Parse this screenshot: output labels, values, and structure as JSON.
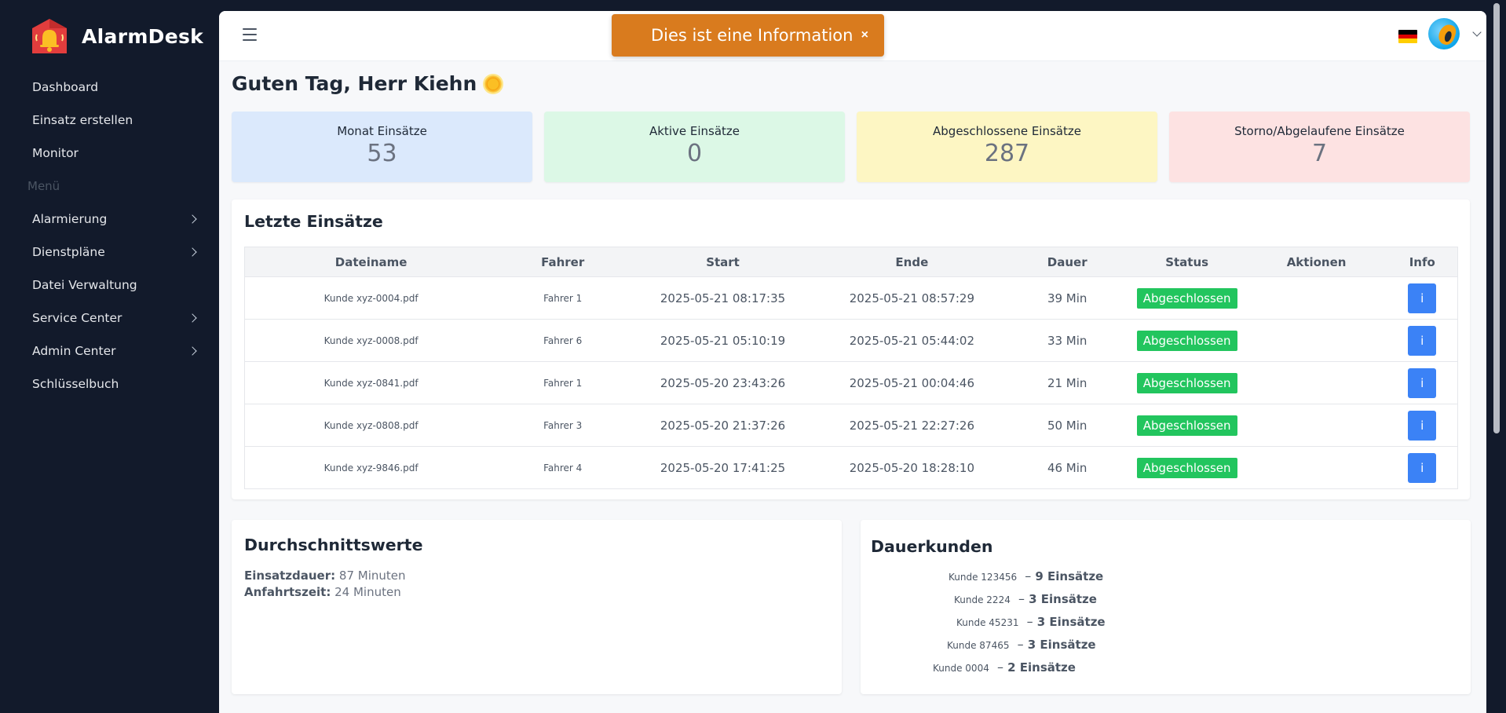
{
  "app": {
    "name": "AlarmDesk"
  },
  "sidebar": {
    "items": [
      {
        "label": "Dashboard"
      },
      {
        "label": "Einsatz erstellen"
      },
      {
        "label": "Monitor"
      }
    ],
    "section_label": "Menü",
    "menu_items": [
      {
        "label": "Alarmierung",
        "has_submenu": true
      },
      {
        "label": "Dienstpläne",
        "has_submenu": true
      },
      {
        "label": "Datei Verwaltung",
        "has_submenu": false
      },
      {
        "label": "Service Center",
        "has_submenu": true
      },
      {
        "label": "Admin Center",
        "has_submenu": true
      },
      {
        "label": "Schlüsselbuch",
        "has_submenu": false
      }
    ]
  },
  "toast": {
    "message": "Dies ist eine Information",
    "close_label": "×"
  },
  "header": {
    "language_flag": "de-flag-icon"
  },
  "greeting": {
    "text": "Guten Tag, Herr Kiehn"
  },
  "stats": [
    {
      "label": "Monat Einsätze",
      "value": "53",
      "color": "#dbe9fc"
    },
    {
      "label": "Aktive Einsätze",
      "value": "0",
      "color": "#dcf8e6"
    },
    {
      "label": "Abgeschlossene Einsätze",
      "value": "287",
      "color": "#fdf6c3"
    },
    {
      "label": "Storno/Abgelaufene Einsätze",
      "value": "7",
      "color": "#fde2e2"
    }
  ],
  "recent": {
    "title": "Letzte Einsätze",
    "columns": [
      "Dateiname",
      "Fahrer",
      "Start",
      "Ende",
      "Dauer",
      "Status",
      "Aktionen",
      "Info"
    ],
    "rows": [
      {
        "file": "Kunde xyz-0004.pdf",
        "driver": "Fahrer 1",
        "start": "2025-05-21 08:17:35",
        "end": "2025-05-21 08:57:29",
        "duration": "39 Min",
        "status": "Abgeschlossen",
        "info": "i"
      },
      {
        "file": "Kunde xyz-0008.pdf",
        "driver": "Fahrer 6",
        "start": "2025-05-21 05:10:19",
        "end": "2025-05-21 05:44:02",
        "duration": "33 Min",
        "status": "Abgeschlossen",
        "info": "i"
      },
      {
        "file": "Kunde xyz-0841.pdf",
        "driver": "Fahrer 1",
        "start": "2025-05-20 23:43:26",
        "end": "2025-05-21 00:04:46",
        "duration": "21 Min",
        "status": "Abgeschlossen",
        "info": "i"
      },
      {
        "file": "Kunde xyz-0808.pdf",
        "driver": "Fahrer 3",
        "start": "2025-05-20 21:37:26",
        "end": "2025-05-21 22:27:26",
        "duration": "50 Min",
        "status": "Abgeschlossen",
        "info": "i"
      },
      {
        "file": "Kunde xyz-9846.pdf",
        "driver": "Fahrer 4",
        "start": "2025-05-20 17:41:25",
        "end": "2025-05-20 18:28:10",
        "duration": "46 Min",
        "status": "Abgeschlossen",
        "info": "i"
      }
    ]
  },
  "averages": {
    "title": "Durchschnittswerte",
    "duration_label": "Einsatzdauer:",
    "duration_value": "87 Minuten",
    "travel_label": "Anfahrtszeit:",
    "travel_value": "24 Minuten"
  },
  "regulars": {
    "title": "Dauerkunden",
    "items": [
      {
        "name": "Kunde 123456",
        "count": "9 Einsätze"
      },
      {
        "name": "Kunde 2224",
        "count": "3 Einsätze"
      },
      {
        "name": "Kunde 45231",
        "count": "3 Einsätze"
      },
      {
        "name": "Kunde 87465",
        "count": "3 Einsätze"
      },
      {
        "name": "Kunde 0004",
        "count": "2 Einsätze"
      }
    ]
  },
  "colors": {
    "sidebar_bg": "#121a2b",
    "toast_bg": "#d97b1e",
    "status_green": "#22c55e",
    "info_blue": "#3b82f6"
  }
}
